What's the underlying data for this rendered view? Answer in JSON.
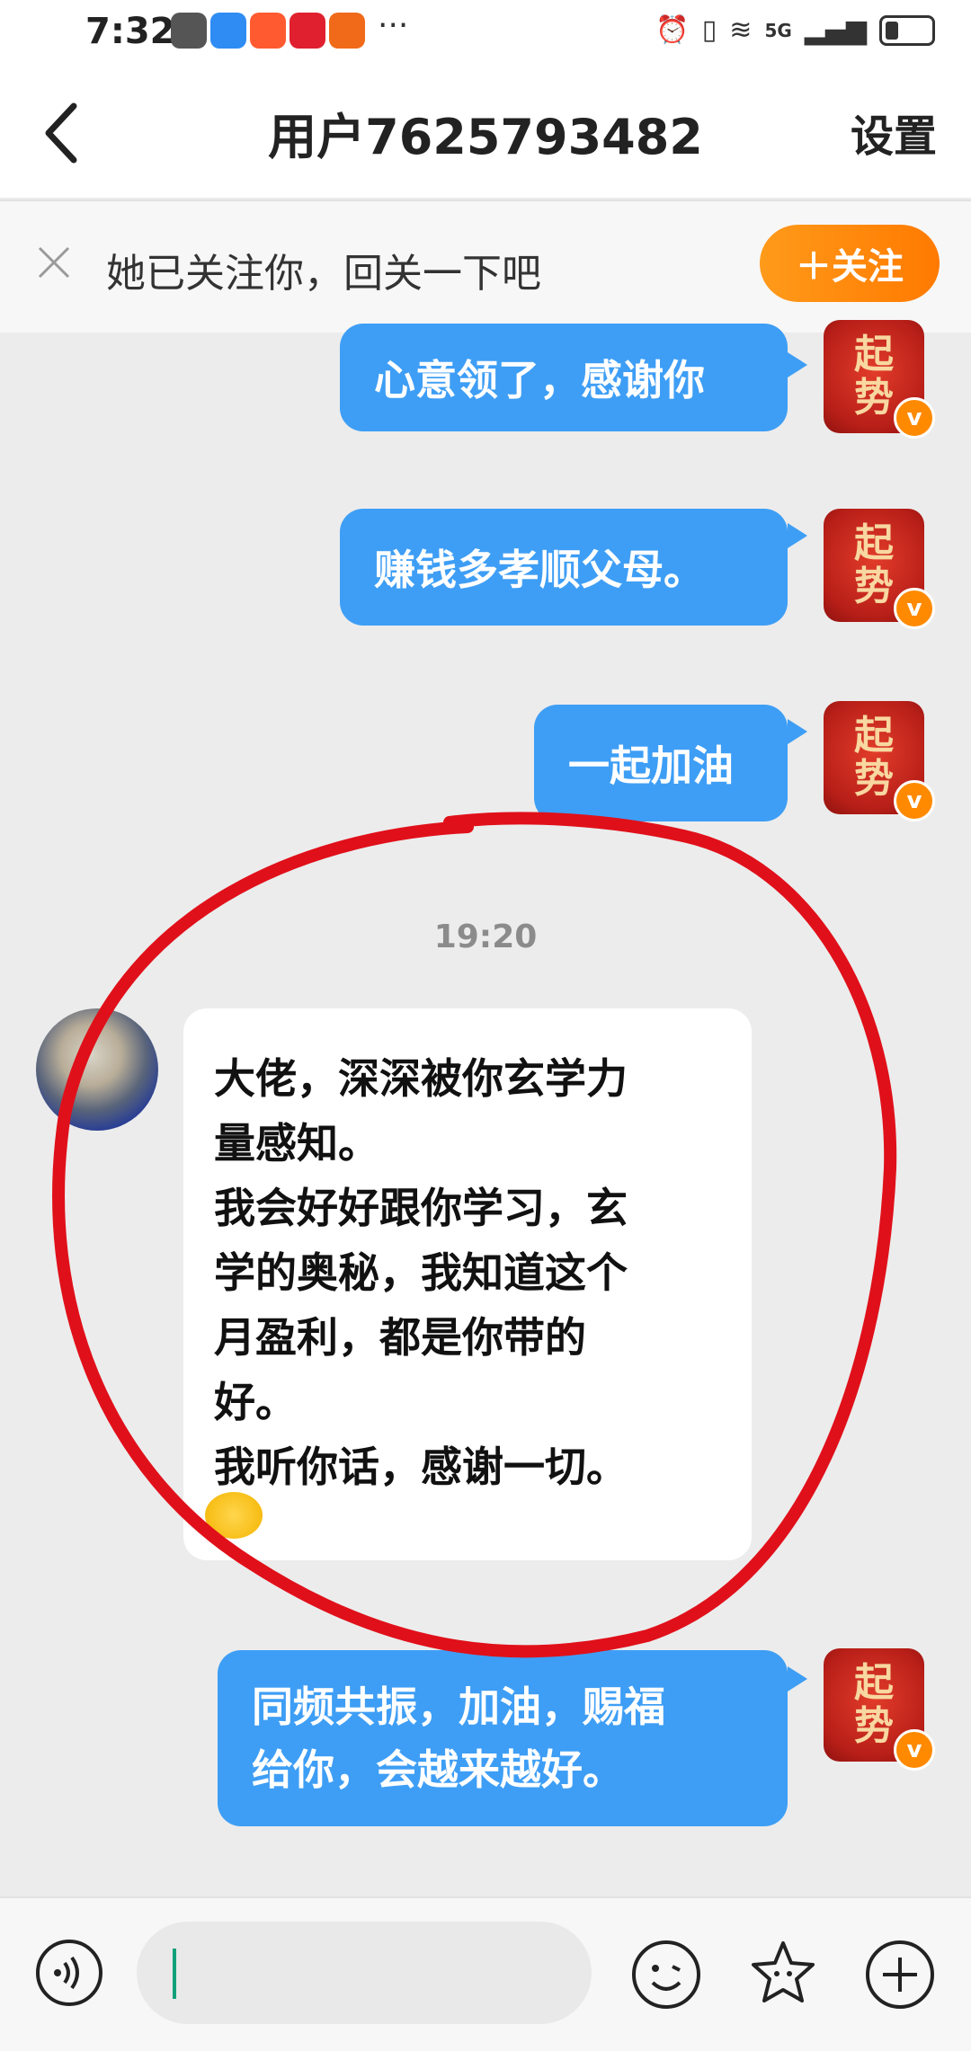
{
  "status_bar": {
    "time": "7:32",
    "network": "5G",
    "more": "···"
  },
  "header": {
    "title": "用户7625793482",
    "settings_label": "设置"
  },
  "banner": {
    "text": "她已关注你，回关一下吧",
    "follow_label": "＋关注"
  },
  "messages": {
    "out1": "心意领了，感谢你",
    "out2": "赚钱多孝顺父母。",
    "out3": "一起加油",
    "timestamp": "19:20",
    "in1_lines": [
      "大佬，深深被你玄学力",
      "量感知。",
      "我会好好跟你学习，玄",
      "学的奥秘，我知道这个",
      "月盈利，都是你带的",
      "好。",
      "我听你话，感谢一切。"
    ],
    "out4_lines": [
      "同频共振，加油，赐福",
      "给你，会越来越好。"
    ]
  },
  "avatar_me": {
    "char1": "起",
    "char2": "势",
    "badge": "v"
  },
  "input": {
    "placeholder": ""
  },
  "colors": {
    "bubble_out": "#3e9ef5",
    "follow_button": "#ff8a00",
    "annotation": "#e0101a"
  },
  "icons": [
    "back-icon",
    "close-icon",
    "voice-icon",
    "emoji-icon",
    "sticker-icon",
    "plus-icon"
  ]
}
